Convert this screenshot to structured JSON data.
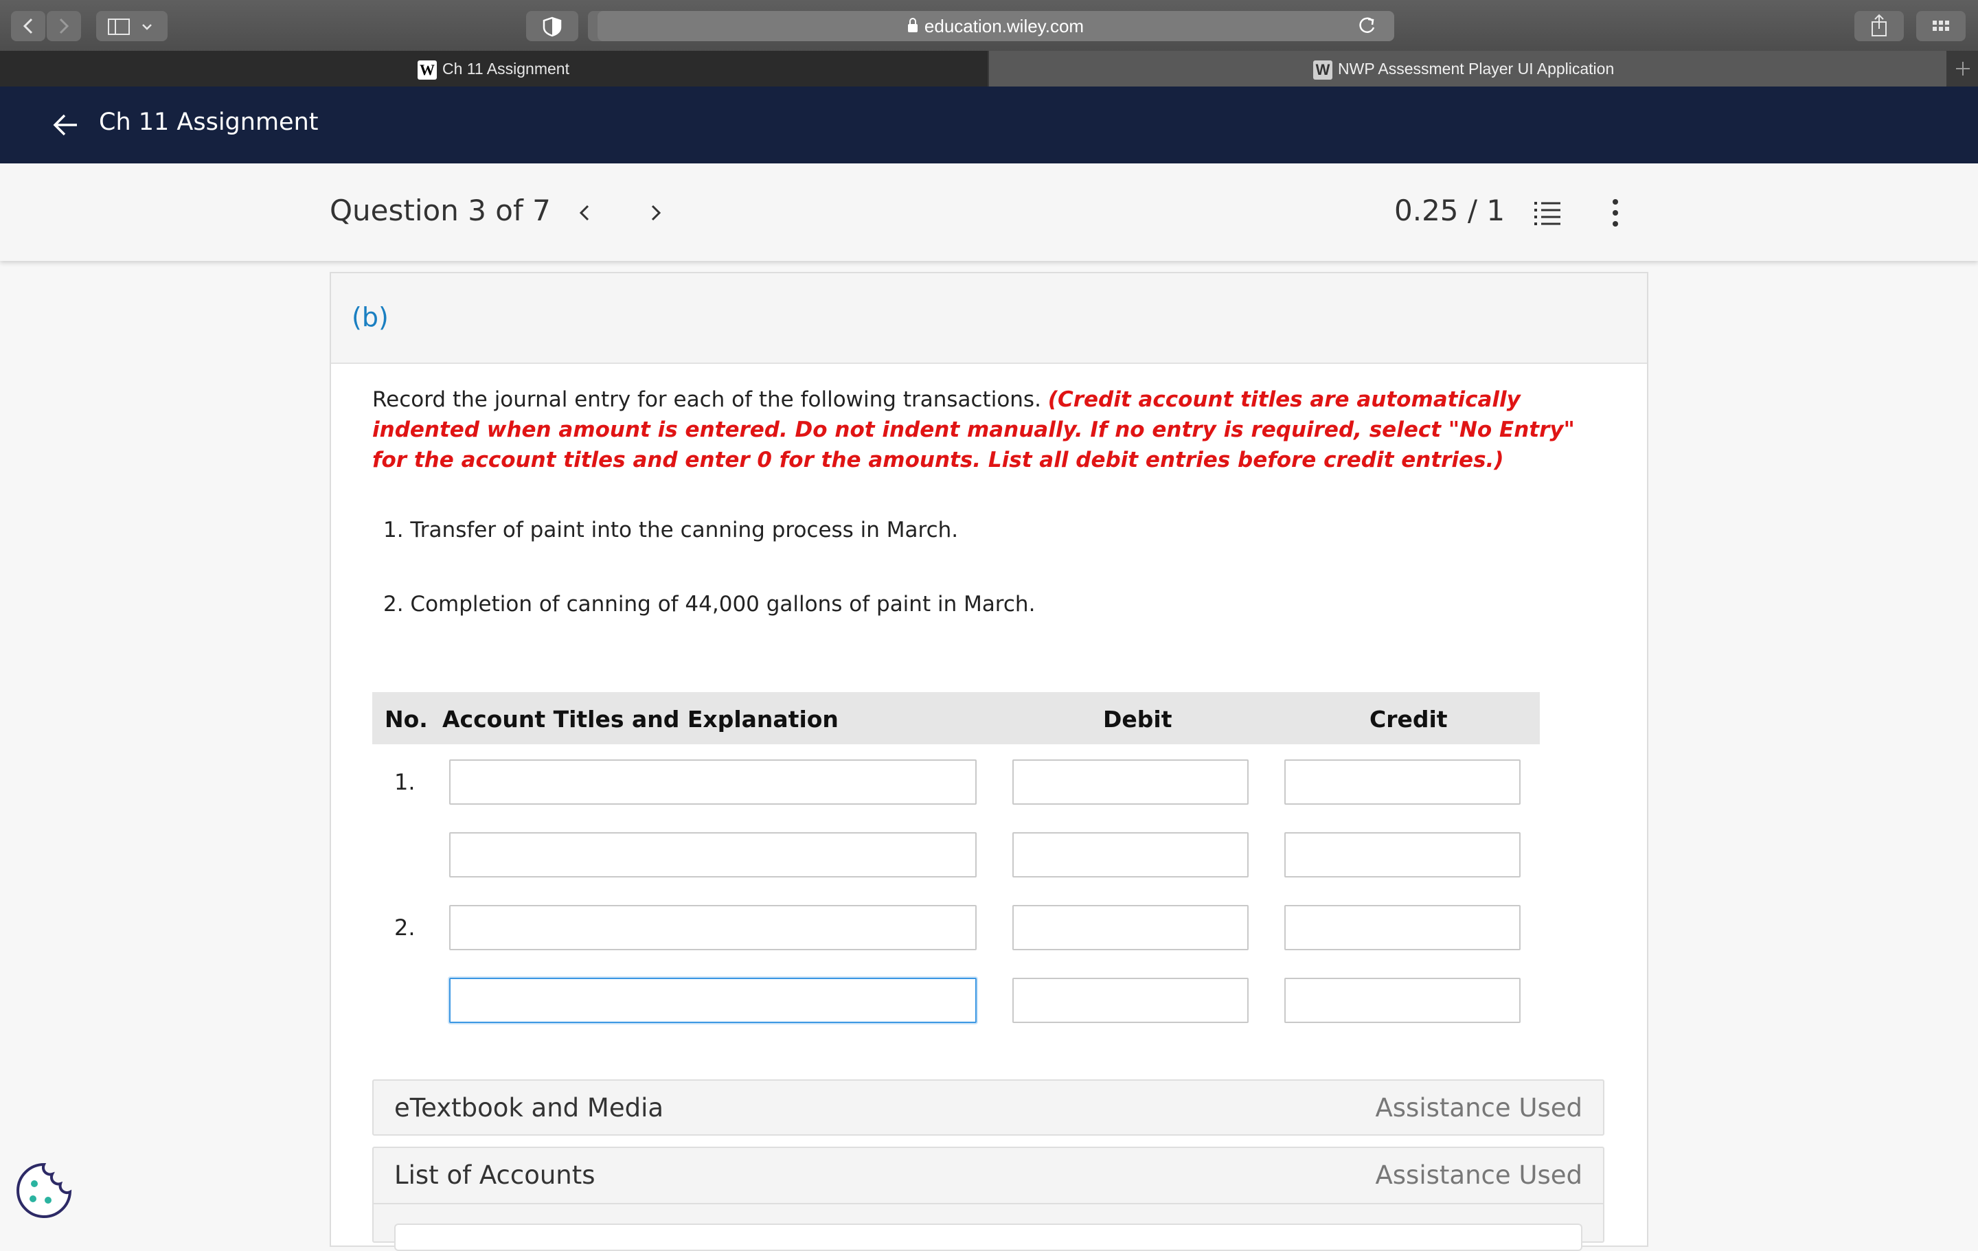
{
  "browser": {
    "url": "education.wiley.com",
    "tabs": [
      {
        "favicon": "W",
        "label": "Ch 11 Assignment"
      },
      {
        "favicon": "W",
        "label": "NWP Assessment Player UI Application"
      }
    ]
  },
  "header": {
    "title": "Ch 11 Assignment"
  },
  "question_nav": {
    "title": "Question 3 of 7",
    "score": "0.25 / 1"
  },
  "part": {
    "label": "(b)"
  },
  "instructions": {
    "text": "Record the journal entry for each of the following transactions. ",
    "note": "(Credit account titles are automatically indented when amount is entered. Do not indent manually. If no entry is required, select \"No Entry\" for the account titles and enter 0 for the amounts. List all debit entries before credit entries.)"
  },
  "transactions": [
    "1. Transfer of paint into the canning process in March.",
    "2. Completion of canning of 44,000 gallons of paint in March."
  ],
  "journal": {
    "headers": {
      "no": "No.",
      "account": "Account Titles and Explanation",
      "debit": "Debit",
      "credit": "Credit"
    },
    "rows": [
      {
        "no": "1.",
        "account": "",
        "debit": "",
        "credit": ""
      },
      {
        "no": "",
        "account": "",
        "debit": "",
        "credit": ""
      },
      {
        "no": "2.",
        "account": "",
        "debit": "",
        "credit": ""
      },
      {
        "no": "",
        "account": "",
        "debit": "",
        "credit": ""
      }
    ]
  },
  "sections": [
    {
      "title": "eTextbook and Media",
      "status": "Assistance Used"
    },
    {
      "title": "List of Accounts",
      "status": "Assistance Used"
    }
  ]
}
